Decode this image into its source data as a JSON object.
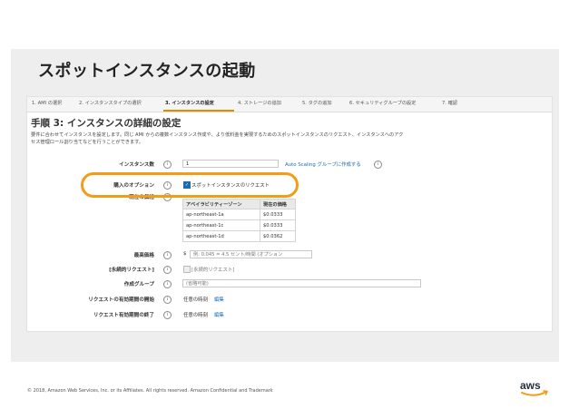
{
  "slide": {
    "title": "スポットインスタンスの起動"
  },
  "wizard_steps": [
    {
      "label": "1. AMI の選択",
      "active": false
    },
    {
      "label": "2. インスタンスタイプの選択",
      "active": false
    },
    {
      "label": "3. インスタンスの設定",
      "active": true
    },
    {
      "label": "4. ストレージの追加",
      "active": false
    },
    {
      "label": "5. タグの追加",
      "active": false
    },
    {
      "label": "6. セキュリティグループの設定",
      "active": false
    },
    {
      "label": "7. 確認",
      "active": false
    }
  ],
  "page": {
    "heading": "手順 3: インスタンスの詳細の設定",
    "description_line1": "要件に合わせてインスタンスを設定します。同じ AMI からの複数インスタンス作成や、より低料金を実現するためのスポットインスタンスのリクエスト、インスタンスへのアク",
    "description_line2": "セス管理ロール割り当てなどを行うことができます。"
  },
  "form": {
    "instance_count": {
      "label": "インスタンス数",
      "value": "1",
      "link": "Auto Scaling グループに作成する"
    },
    "purchase_option": {
      "label": "購入のオプション",
      "checkbox_label": "スポットインスタンスのリクエスト",
      "checked": true
    },
    "current_price": {
      "label": "現在の価格",
      "headers": [
        "アベイラビリティーゾーン",
        "現在の価格"
      ],
      "rows": [
        [
          "ap-northeast-1a",
          "$0.0333"
        ],
        [
          "ap-northeast-1c",
          "$0.0333"
        ],
        [
          "ap-northeast-1d",
          "$0.0362"
        ]
      ]
    },
    "max_price": {
      "label": "最高価格",
      "currency": "$",
      "placeholder": "例: 0.045 = 4.5 セント/時間 (オプション"
    },
    "persistent_request": {
      "label": "[永続的リクエスト]",
      "checkbox_label": "[永続的リクエスト]",
      "checked": false
    },
    "launch_group": {
      "label": "作成グループ",
      "placeholder": "(省略可能)"
    },
    "valid_from": {
      "label": "リクエストの有効期間の開始",
      "value": "任意の時刻",
      "edit": "編集"
    },
    "valid_until": {
      "label": "リクエスト有効期間の終了",
      "value": "任意の時刻",
      "edit": "編集"
    }
  },
  "footer": {
    "text": "© 2018, Amazon Web Services, Inc. or its Affiliates. All rights reserved. Amazon Confidential and Trademark"
  },
  "logo": {
    "text": "aws"
  },
  "colors": {
    "highlight": "#f29d15",
    "link": "#1a6bb0",
    "aws_smile": "#f29d15"
  }
}
